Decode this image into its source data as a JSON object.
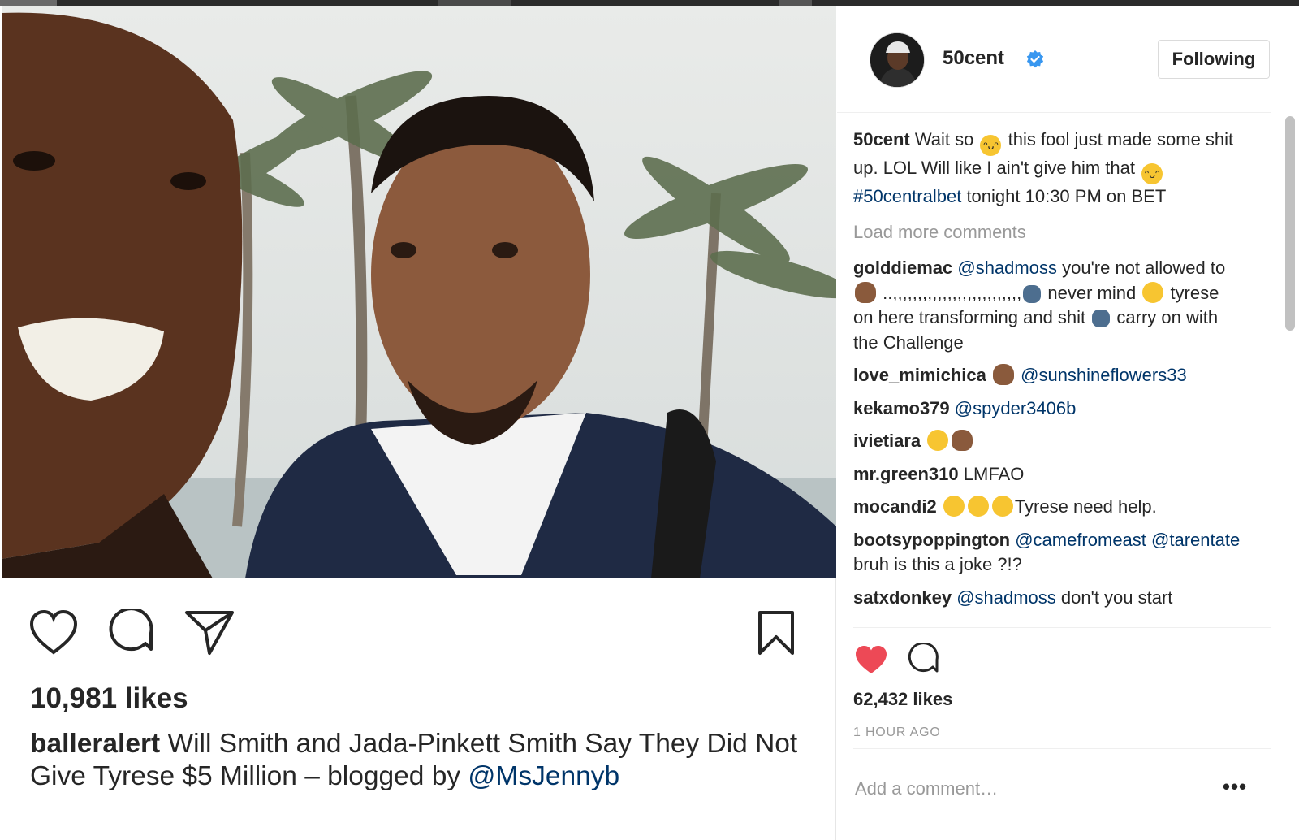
{
  "left_post": {
    "likes": "10,981 likes",
    "caption_user": "balleralert",
    "caption_text": " Will Smith and Jada-Pinkett Smith Say They Did Not Give Tyrese $5 Million – blogged by ",
    "caption_mention": "@MsJennyb"
  },
  "right_panel": {
    "username": "50cent",
    "follow_label": "Following",
    "main_comment": {
      "user": "50cent",
      "part1": " Wait so ",
      "part2": " this fool just made some shit up. LOL Will like I ain't give him that ",
      "hashtag": "#50centralbet",
      "part3": " tonight 10:30 PM on BET"
    },
    "load_more": "Load more comments",
    "comments": [
      {
        "user": "golddiemac",
        "mention": "@shadmoss",
        "text1": " you're not allowed to ",
        "text2": " ..,,,,,,,,,,,,,,,,,,,,,,,,,,",
        "text3": " never mind ",
        "text4": "  tyrese on here transforming and shit ",
        "text5": " carry on with the Challenge"
      },
      {
        "user": "love_mimichica",
        "mention": "@sunshineflowers33"
      },
      {
        "user": "kekamo379",
        "mention": "@spyder3406b"
      },
      {
        "user": "ivietiara"
      },
      {
        "user": "mr.green310",
        "text": " LMFAO"
      },
      {
        "user": "mocandi2",
        "text": "Tyrese need help."
      },
      {
        "user": "bootsypoppington",
        "mention1": "@camefromeast",
        "mention2": "@tarentate",
        "text": " bruh is this a joke ?!?"
      },
      {
        "user": "satxdonkey",
        "mention": "@shadmoss",
        "text": " don't you start"
      }
    ],
    "likes": "62,432 likes",
    "time_ago": "1 HOUR AGO",
    "add_comment_placeholder": "Add a comment…",
    "more_label": "•••"
  },
  "colors": {
    "accent_blue": "#3897f0",
    "mention_blue": "#003569",
    "like_red": "#ed4956",
    "muted_gray": "#999999",
    "text": "#262626"
  },
  "icons": [
    "heart-icon",
    "comment-icon",
    "share-icon",
    "bookmark-icon",
    "verified-badge-icon",
    "heart-filled-icon"
  ]
}
